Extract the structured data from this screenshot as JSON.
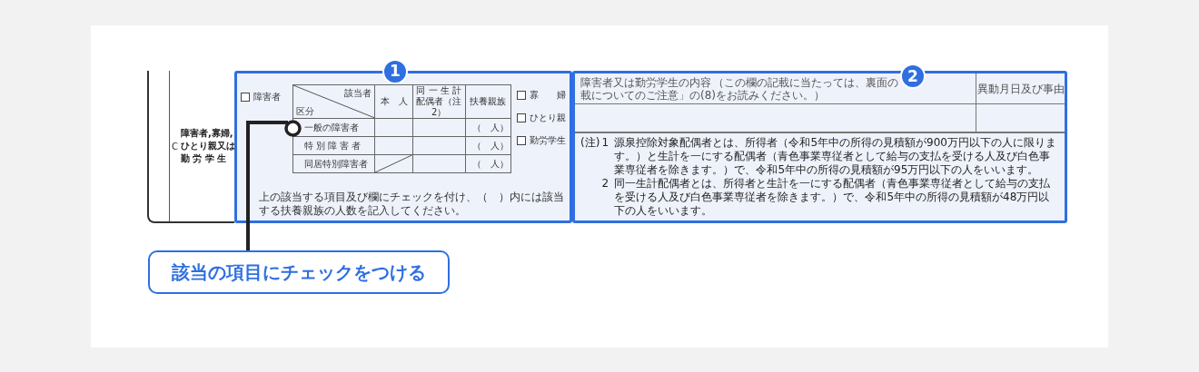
{
  "left_panel": {
    "letter": "C",
    "lines": [
      "障害者,寡婦,",
      "ひとり親又は",
      "勤 労 学 生"
    ]
  },
  "section_1": {
    "badge": "1",
    "checkbox": {
      "label": "障害者",
      "checked": false
    },
    "table": {
      "corner_top": "該当者",
      "corner_bottom": "区分",
      "columns": [
        {
          "lines": [
            "本　人"
          ]
        },
        {
          "lines": [
            "同 一 生 計",
            "配偶者（注2）"
          ]
        },
        {
          "lines": [
            "扶養親族"
          ]
        }
      ],
      "rows": [
        {
          "label": "一般の障害者",
          "cells": [
            {
              "kind": "blank"
            },
            {
              "kind": "blank"
            },
            {
              "kind": "count",
              "text": "（　人）"
            }
          ]
        },
        {
          "label": "特 別 障 害 者",
          "cells": [
            {
              "kind": "blank"
            },
            {
              "kind": "blank"
            },
            {
              "kind": "count",
              "text": "（　人）"
            }
          ]
        },
        {
          "label": "同居特別障害者",
          "cells": [
            {
              "kind": "struck"
            },
            {
              "kind": "blank"
            },
            {
              "kind": "count",
              "text": "（　人）"
            }
          ]
        }
      ]
    },
    "checkboxes": [
      {
        "label": "寡　　婦",
        "checked": false
      },
      {
        "label": "ひとり親",
        "checked": false
      },
      {
        "label": "勤労学生",
        "checked": false
      }
    ],
    "footer": "上の該当する項目及び欄にチェックを付け、（　）内には該当する扶養親族の人数を記入してください。"
  },
  "section_2": {
    "badge": "2",
    "title": "障害者又は勤労学生の内容",
    "note_parts": [
      "（この欄の記載に当たっては、裏面の",
      "載についてのご注意」の(8)をお読みください。）"
    ],
    "column_2": "異動月日及び事由",
    "notes": {
      "prefix": "(注)",
      "items": [
        {
          "number": "1",
          "text": "源泉控除対象配偶者とは、所得者（令和5年中の所得の見積額が900万円以下の人に限ります。）と生計を一にする配偶者（青色事業専従者として給与の支払を受ける人及び白色事業専従者を除きます。）で、令和5年中の所得の見積額が95万円以下の人をいいます。"
        },
        {
          "number": "2",
          "text": "同一生計配偶者とは、所得者と生計を一にする配偶者（青色事業専従者として給与の支払を受ける人及び白色事業専従者を除きます。）で、令和5年中の所得の見積額が48万円以下の人をいいます。"
        }
      ]
    }
  },
  "callout": "該当の項目にチェックをつける"
}
